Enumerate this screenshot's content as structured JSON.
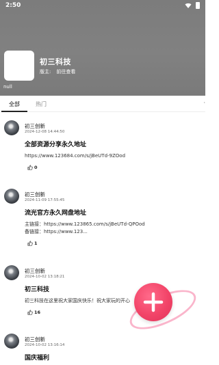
{
  "status": {
    "time": "2:50"
  },
  "header": {
    "title": "初三科技",
    "moderator_label": "版主:",
    "moderator_link": "前往查看",
    "null_text": "null"
  },
  "tabs": [
    {
      "label": "全部"
    },
    {
      "label": "热门"
    }
  ],
  "posts": [
    {
      "author": "初三创新",
      "time": "2024-12-08 14:44:50",
      "title": "全部资源分享永久地址",
      "body_lines": [
        "https://www.123684.com/s/jBeUTd-9ZOod"
      ],
      "likes": "0"
    },
    {
      "author": "初三创新",
      "time": "2024-11-09 17:55:45",
      "title": "流光官方永久网盘地址",
      "body_lines": [
        "主链接：https://www.123865.com/s/jBeUTd-QPOod",
        "备链接：https://www.123..."
      ],
      "likes": "1"
    },
    {
      "author": "初三创新",
      "time": "2024-10-02 13:18:21",
      "title": "初三科技",
      "body_lines": [
        "初三科技在这里祝大家国庆快乐！祝大家玩的开心"
      ],
      "likes": "16"
    },
    {
      "author": "初三创新",
      "time": "2024-10-02 13:16:14",
      "title": "国庆福利",
      "body_lines": [],
      "likes": ""
    }
  ],
  "colors": {
    "header_bg": "#7f7f7f",
    "fab": "#f24468"
  }
}
